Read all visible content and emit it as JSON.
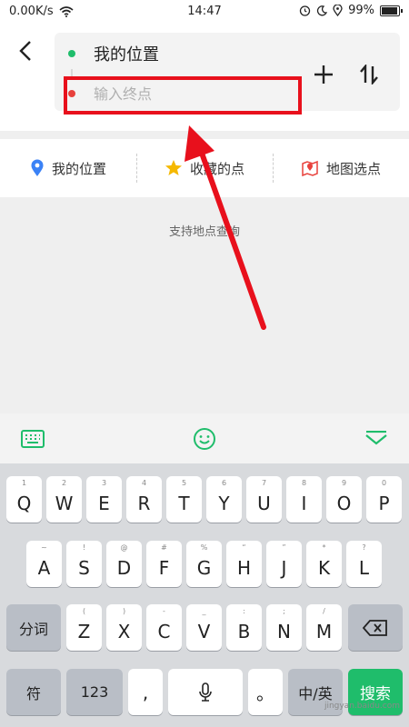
{
  "status_bar": {
    "speed": "0.00K/s",
    "time": "14:47",
    "battery": "99%",
    "battery_level": 0.99
  },
  "route": {
    "start_label": "我的位置",
    "end_placeholder": "输入终点",
    "end_value": ""
  },
  "quick_options": [
    {
      "label": "我的位置",
      "icon": "location-pin-icon"
    },
    {
      "label": "收藏的点",
      "icon": "star-icon"
    },
    {
      "label": "地图选点",
      "icon": "map-pin-icon"
    }
  ],
  "hint_text": "支持地点查询",
  "keyboard": {
    "row1": [
      {
        "sub": "1",
        "main": "Q"
      },
      {
        "sub": "2",
        "main": "W"
      },
      {
        "sub": "3",
        "main": "E"
      },
      {
        "sub": "4",
        "main": "R"
      },
      {
        "sub": "5",
        "main": "T"
      },
      {
        "sub": "6",
        "main": "Y"
      },
      {
        "sub": "7",
        "main": "U"
      },
      {
        "sub": "8",
        "main": "I"
      },
      {
        "sub": "9",
        "main": "O"
      },
      {
        "sub": "0",
        "main": "P"
      }
    ],
    "row2": [
      {
        "sub": "~",
        "main": "A"
      },
      {
        "sub": "!",
        "main": "S"
      },
      {
        "sub": "@",
        "main": "D"
      },
      {
        "sub": "#",
        "main": "F"
      },
      {
        "sub": "%",
        "main": "G"
      },
      {
        "sub": "“",
        "main": "H"
      },
      {
        "sub": "”",
        "main": "J"
      },
      {
        "sub": "*",
        "main": "K"
      },
      {
        "sub": "?",
        "main": "L"
      }
    ],
    "row3": [
      {
        "sub": "(",
        "main": "Z"
      },
      {
        "sub": ")",
        "main": "X"
      },
      {
        "sub": "-",
        "main": "C"
      },
      {
        "sub": "_",
        "main": "V"
      },
      {
        "sub": ":",
        "main": "B"
      },
      {
        "sub": ";",
        "main": "N"
      },
      {
        "sub": "/",
        "main": "M"
      }
    ],
    "segment_key": "分词",
    "symbol_key": "符",
    "number_key": "123",
    "comma_key": ",",
    "period_key": "。",
    "lang_key": "中/英",
    "search_key": "搜索"
  },
  "watermark": "jingyan.baidu.com",
  "colors": {
    "accent": "#1fbd6b",
    "annotation": "#e8101c",
    "start_dot": "#1fbd6b",
    "end_dot": "#e8413c"
  }
}
